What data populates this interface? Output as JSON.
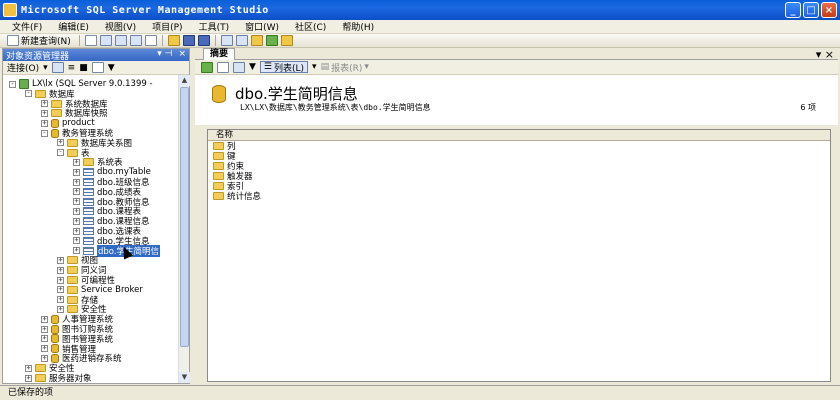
{
  "window": {
    "title": "Microsoft SQL Server Management Studio"
  },
  "menu": [
    "文件(F)",
    "编辑(E)",
    "视图(V)",
    "项目(P)",
    "工具(T)",
    "窗口(W)",
    "社区(C)",
    "帮助(H)"
  ],
  "toolbar": {
    "new_query": "新建查询(N)"
  },
  "object_explorer": {
    "title": "对象资源管理器",
    "connect": "连接(O)",
    "tree": [
      {
        "label": "LX\\lx (SQL Server 9.0.1399 -",
        "level": 0,
        "exp": "-",
        "icon": "server"
      },
      {
        "label": "数据库",
        "level": 1,
        "exp": "-",
        "icon": "folder"
      },
      {
        "label": "系统数据库",
        "level": 2,
        "exp": "+",
        "icon": "folder"
      },
      {
        "label": "数据库快照",
        "level": 2,
        "exp": "+",
        "icon": "folder"
      },
      {
        "label": "product",
        "level": 2,
        "exp": "+",
        "icon": "db"
      },
      {
        "label": "教务管理系统",
        "level": 2,
        "exp": "-",
        "icon": "db"
      },
      {
        "label": "数据库关系图",
        "level": 3,
        "exp": "+",
        "icon": "folder"
      },
      {
        "label": "表",
        "level": 3,
        "exp": "-",
        "icon": "folder"
      },
      {
        "label": "系统表",
        "level": 4,
        "exp": "+",
        "icon": "folder"
      },
      {
        "label": "dbo.myTable",
        "level": 4,
        "exp": "+",
        "icon": "table"
      },
      {
        "label": "dbo.班级信息",
        "level": 4,
        "exp": "+",
        "icon": "table"
      },
      {
        "label": "dbo.成绩表",
        "level": 4,
        "exp": "+",
        "icon": "table"
      },
      {
        "label": "dbo.教师信息",
        "level": 4,
        "exp": "+",
        "icon": "table"
      },
      {
        "label": "dbo.课程表",
        "level": 4,
        "exp": "+",
        "icon": "table"
      },
      {
        "label": "dbo.课程信息",
        "level": 4,
        "exp": "+",
        "icon": "table"
      },
      {
        "label": "dbo.选课表",
        "level": 4,
        "exp": "+",
        "icon": "table"
      },
      {
        "label": "dbo.学生信息",
        "level": 4,
        "exp": "+",
        "icon": "table"
      },
      {
        "label": "dbo.学生简明信",
        "level": 4,
        "exp": "+",
        "icon": "table",
        "selected": true
      },
      {
        "label": "视图",
        "level": 3,
        "exp": "+",
        "icon": "folder"
      },
      {
        "label": "同义词",
        "level": 3,
        "exp": "+",
        "icon": "folder"
      },
      {
        "label": "可编程性",
        "level": 3,
        "exp": "+",
        "icon": "folder"
      },
      {
        "label": "Service Broker",
        "level": 3,
        "exp": "+",
        "icon": "folder"
      },
      {
        "label": "存储",
        "level": 3,
        "exp": "+",
        "icon": "folder"
      },
      {
        "label": "安全性",
        "level": 3,
        "exp": "+",
        "icon": "folder"
      },
      {
        "label": "人事管理系统",
        "level": 2,
        "exp": "+",
        "icon": "db"
      },
      {
        "label": "图书订购系统",
        "level": 2,
        "exp": "+",
        "icon": "db"
      },
      {
        "label": "图书管理系统",
        "level": 2,
        "exp": "+",
        "icon": "db"
      },
      {
        "label": "销售管理",
        "level": 2,
        "exp": "+",
        "icon": "db"
      },
      {
        "label": "医药进销存系统",
        "level": 2,
        "exp": "+",
        "icon": "db"
      },
      {
        "label": "安全性",
        "level": 1,
        "exp": "+",
        "icon": "folder"
      },
      {
        "label": "服务器对象",
        "level": 1,
        "exp": "+",
        "icon": "folder"
      }
    ]
  },
  "summary": {
    "tab": "摘要",
    "list_button": "列表(L)",
    "report_button": "报表(R)",
    "title": "dbo.学生简明信息",
    "path": "LX\\LX\\数据库\\教务管理系统\\表\\dbo.学生简明信息",
    "count": "6 项",
    "column_header": "名称",
    "items": [
      "列",
      "键",
      "约束",
      "触发器",
      "索引",
      "统计信息"
    ]
  },
  "status": {
    "text": "已保存的项"
  }
}
